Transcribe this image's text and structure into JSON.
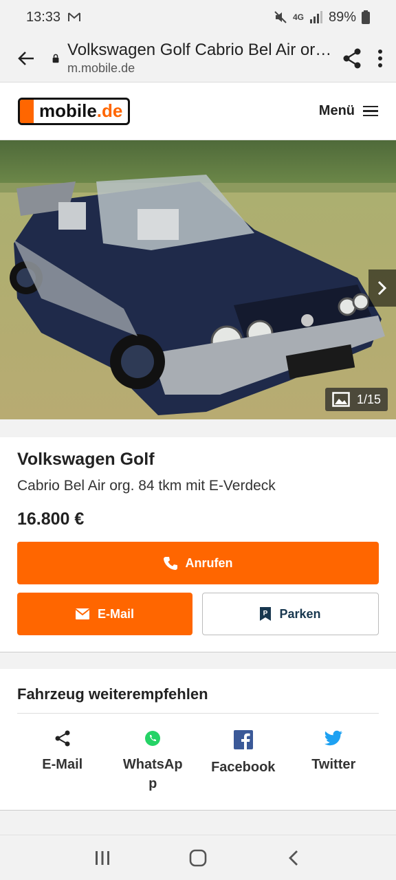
{
  "status_bar": {
    "time": "13:33",
    "battery": "89%"
  },
  "browser": {
    "title": "Volkswagen Golf Cabrio Bel Air org. 84 tkm mit E-Verdeck",
    "url": "m.mobile.de"
  },
  "site": {
    "logo_main": "mobile",
    "logo_suffix": ".de",
    "menu_label": "Menü"
  },
  "gallery": {
    "counter": "1/15"
  },
  "listing": {
    "title": "Volkswagen Golf",
    "subtitle": "Cabrio Bel Air org. 84 tkm mit E-Verdeck",
    "price": "16.800 €",
    "call_label": "Anrufen",
    "email_label": "E-Mail",
    "park_label": "Parken"
  },
  "share": {
    "heading": "Fahrzeug weiterempfehlen",
    "items": [
      {
        "label": "E-Mail",
        "icon": "share-icon"
      },
      {
        "label": "WhatsApp",
        "icon": "whatsapp-icon"
      },
      {
        "label": "Facebook",
        "icon": "facebook-icon"
      },
      {
        "label": "Twitter",
        "icon": "twitter-icon"
      }
    ]
  },
  "colors": {
    "accent": "#ff6600",
    "whatsapp": "#25d366",
    "facebook": "#3b5998",
    "twitter": "#1da1f2"
  }
}
